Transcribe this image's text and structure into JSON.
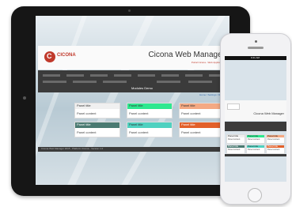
{
  "tablet": {
    "logo_letter": "C",
    "logo_text": "CICONA",
    "title": "Cicona Web Manager",
    "subtitle": "Portal Cicona - Web Application",
    "nav_active": "Modules Demo",
    "breadcrumb": "Home / Settings / Demo",
    "panels": [
      {
        "title": "Panel title",
        "content": "Panel content",
        "color": "#f0f0f0"
      },
      {
        "title": "Panel title",
        "content": "Panel content",
        "color": "#2ee88f"
      },
      {
        "title": "Panel title",
        "content": "Panel content",
        "color": "#f4a983"
      },
      {
        "title": "Panel title",
        "content": "Panel content",
        "color": "#4a7a72"
      },
      {
        "title": "Panel title",
        "content": "Panel content",
        "color": "#4fd1c0"
      },
      {
        "title": "Panel title",
        "content": "Panel content",
        "color": "#e2602a"
      }
    ],
    "footer": "Cicona Web Manager 2015 - Platform Cicona - Version 1.0"
  },
  "phone": {
    "status_time": "9:41 AM",
    "title": "Cicona Web Manager",
    "panels": [
      {
        "title": "Panel title",
        "content": "Panel content",
        "color": "#f0f0f0"
      },
      {
        "title": "Panel title",
        "content": "Panel content",
        "color": "#2ee88f"
      },
      {
        "title": "Panel title",
        "content": "Panel content",
        "color": "#f4a983"
      },
      {
        "title": "Panel title",
        "content": "Panel content",
        "color": "#4a7a72"
      },
      {
        "title": "Panel title",
        "content": "Panel content",
        "color": "#4fd1c0"
      },
      {
        "title": "Panel title",
        "content": "Panel content",
        "color": "#e2602a"
      }
    ]
  }
}
